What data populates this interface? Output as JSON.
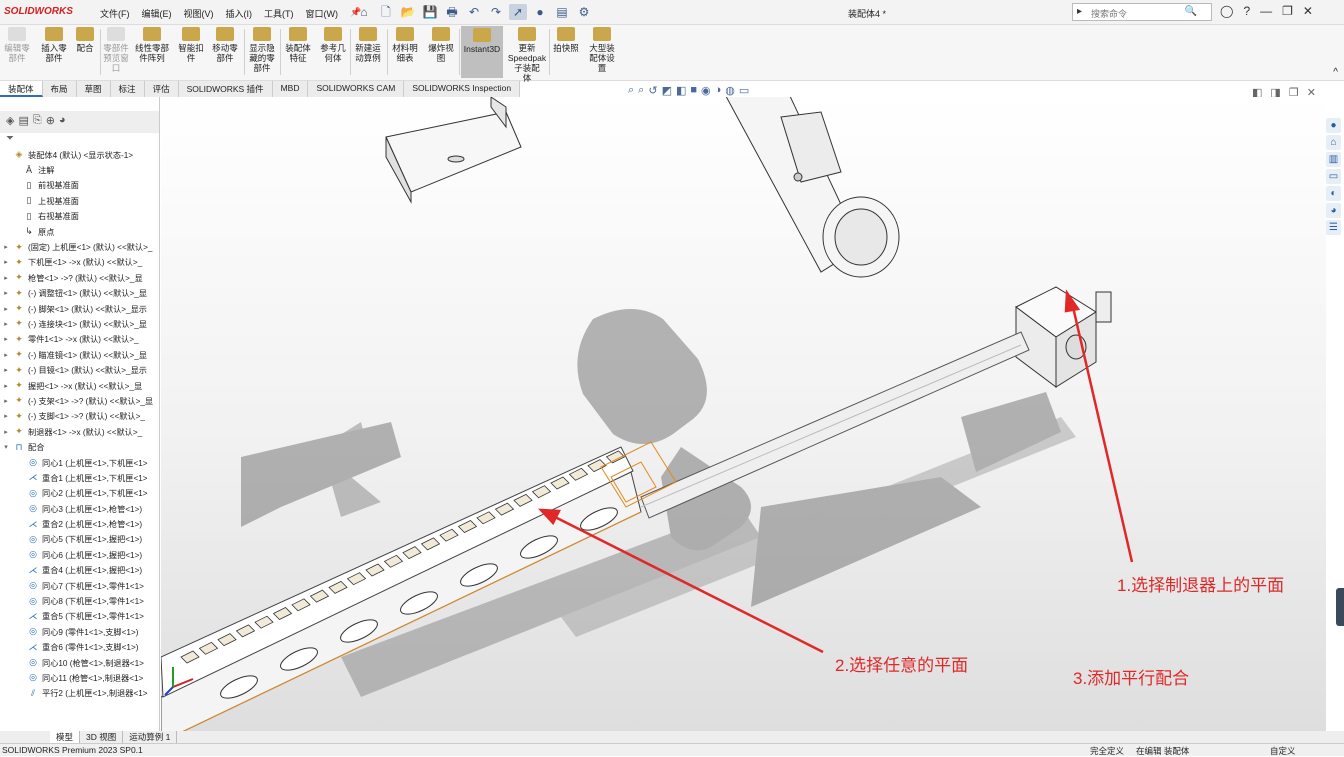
{
  "app": {
    "logo": "SOLIDWORKS",
    "doc_title": "装配体4 *",
    "search_placeholder": "搜索命令"
  },
  "menus": [
    "文件(F)",
    "编辑(E)",
    "视图(V)",
    "插入(I)",
    "工具(T)",
    "窗口(W)"
  ],
  "ribbon": [
    {
      "label": "编辑零\n部件",
      "disabled": true
    },
    {
      "label": "插入零\n部件",
      "disabled": false
    },
    {
      "label": "配合",
      "disabled": false
    },
    {
      "label": "零部件\n预览窗\n口",
      "disabled": true
    },
    {
      "label": "线性零部\n件阵列",
      "disabled": false
    },
    {
      "label": "智能扣\n件",
      "disabled": false
    },
    {
      "label": "移动零\n部件",
      "disabled": false
    },
    {
      "label": "显示隐\n藏的零\n部件",
      "disabled": false
    },
    {
      "label": "装配体\n特征",
      "disabled": false
    },
    {
      "label": "参考几\n何体",
      "disabled": false
    },
    {
      "label": "新建运\n动算例",
      "disabled": false
    },
    {
      "label": "材料明\n细表",
      "disabled": false
    },
    {
      "label": "爆炸视\n图",
      "disabled": false
    },
    {
      "label": "Instant3D",
      "disabled": false,
      "active": true
    },
    {
      "label": "更新\nSpeedpak\n子装配\n体",
      "disabled": false
    },
    {
      "label": "拍快照",
      "disabled": false
    },
    {
      "label": "大型装\n配体设\n置",
      "disabled": false
    }
  ],
  "tabs": [
    "装配体",
    "布局",
    "草图",
    "标注",
    "评估",
    "SOLIDWORKS 插件",
    "MBD",
    "SOLIDWORKS CAM",
    "SOLIDWORKS Inspection"
  ],
  "tree": [
    {
      "text": "装配体4 (默认) <显示状态-1>",
      "icon": "assembly-icon",
      "exp": ""
    },
    {
      "text": "注解",
      "icon": "annotation-icon",
      "exp": ""
    },
    {
      "text": "前视基准面",
      "icon": "plane-icon",
      "exp": ""
    },
    {
      "text": "上视基准面",
      "icon": "plane-icon",
      "exp": ""
    },
    {
      "text": "右视基准面",
      "icon": "plane-icon",
      "exp": ""
    },
    {
      "text": "原点",
      "icon": "origin-icon",
      "exp": ""
    },
    {
      "text": "(固定) 上机匣<1> (默认) <<默认>_",
      "icon": "part-icon",
      "exp": "▸"
    },
    {
      "text": "下机匣<1> ->x (默认) <<默认>_",
      "icon": "part-icon",
      "exp": "▸"
    },
    {
      "text": "枪管<1> ->? (默认) <<默认>_显",
      "icon": "part-icon",
      "exp": "▸"
    },
    {
      "text": "(-) 调整钮<1> (默认) <<默认>_显",
      "icon": "part-icon",
      "exp": "▸"
    },
    {
      "text": "(-) 脚架<1> (默认) <<默认>_显示",
      "icon": "part-icon",
      "exp": "▸"
    },
    {
      "text": "(-) 连接块<1> (默认) <<默认>_显",
      "icon": "part-icon",
      "exp": "▸"
    },
    {
      "text": "零件1<1> ->x (默认) <<默认>_",
      "icon": "part-icon",
      "exp": "▸"
    },
    {
      "text": "(-) 瞄准镜<1> (默认) <<默认>_显",
      "icon": "part-icon",
      "exp": "▸"
    },
    {
      "text": "(-) 目镜<1> (默认) <<默认>_显示",
      "icon": "part-icon",
      "exp": "▸"
    },
    {
      "text": "握把<1> ->x (默认) <<默认>_显",
      "icon": "part-icon",
      "exp": "▸"
    },
    {
      "text": "(-) 支架<1> ->? (默认) <<默认>_显",
      "icon": "part-icon",
      "exp": "▸"
    },
    {
      "text": "(-) 支脚<1> ->? (默认) <<默认>_",
      "icon": "part-icon",
      "exp": "▸"
    },
    {
      "text": "制退器<1> ->x (默认) <<默认>_",
      "icon": "part-icon",
      "exp": "▸"
    },
    {
      "text": "配合",
      "icon": "mates-icon",
      "exp": "▾"
    },
    {
      "text": "同心1 (上机匣<1>,下机匣<1>",
      "icon": "concentric-icon",
      "exp": ""
    },
    {
      "text": "重合1 (上机匣<1>,下机匣<1>",
      "icon": "coincident-icon",
      "exp": ""
    },
    {
      "text": "同心2 (上机匣<1>,下机匣<1>",
      "icon": "concentric-icon",
      "exp": ""
    },
    {
      "text": "同心3 (上机匣<1>,枪管<1>)",
      "icon": "concentric-icon",
      "exp": ""
    },
    {
      "text": "重合2 (上机匣<1>,枪管<1>)",
      "icon": "coincident-icon",
      "exp": ""
    },
    {
      "text": "同心5 (下机匣<1>,握把<1>)",
      "icon": "concentric-icon",
      "exp": ""
    },
    {
      "text": "同心6 (上机匣<1>,握把<1>)",
      "icon": "concentric-icon",
      "exp": ""
    },
    {
      "text": "重合4 (上机匣<1>,握把<1>)",
      "icon": "coincident-icon",
      "exp": ""
    },
    {
      "text": "同心7 (下机匣<1>,零件1<1>",
      "icon": "concentric-icon",
      "exp": ""
    },
    {
      "text": "同心8 (下机匣<1>,零件1<1>",
      "icon": "concentric-icon",
      "exp": ""
    },
    {
      "text": "重合5 (下机匣<1>,零件1<1>",
      "icon": "coincident-icon",
      "exp": ""
    },
    {
      "text": "同心9 (零件1<1>,支脚<1>)",
      "icon": "concentric-icon",
      "exp": ""
    },
    {
      "text": "重合6 (零件1<1>,支脚<1>)",
      "icon": "coincident-icon",
      "exp": ""
    },
    {
      "text": "同心10 (枪管<1>,制退器<1>",
      "icon": "concentric-icon",
      "exp": ""
    },
    {
      "text": "同心11 (枪管<1>,制退器<1>",
      "icon": "concentric-icon",
      "exp": ""
    },
    {
      "text": "平行2 (上机匣<1>,制退器<1>",
      "icon": "parallel-icon",
      "exp": ""
    }
  ],
  "annotations": {
    "n1": "1.选择制退器上的平面",
    "n2": "2.选择任意的平面",
    "n3": "3.添加平行配合",
    "color": "#e02828"
  },
  "bottom_tabs": [
    "模型",
    "3D 视图",
    "运动算例 1"
  ],
  "status": {
    "left": "SOLIDWORKS Premium 2023 SP0.1",
    "s1": "完全定义",
    "s2": "在编辑 装配体",
    "s3": "自定义"
  }
}
